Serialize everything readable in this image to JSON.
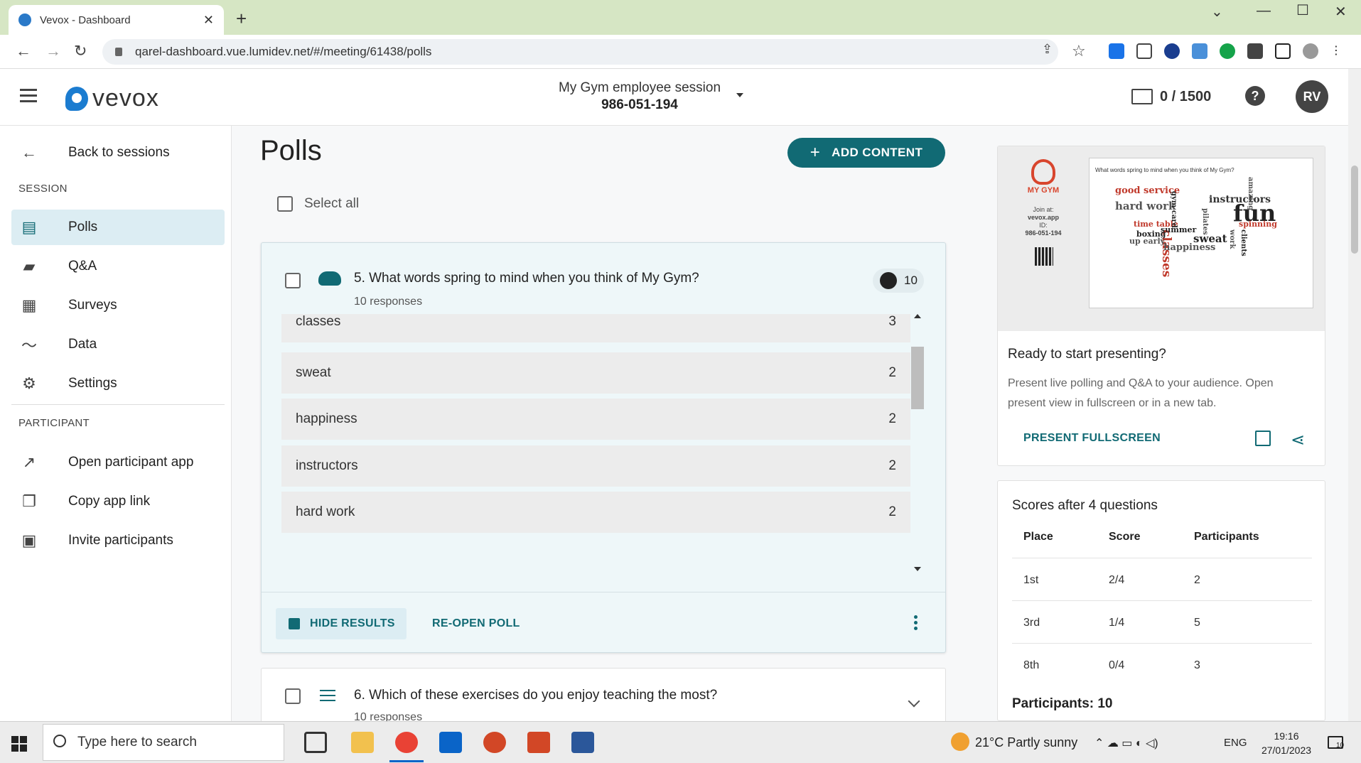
{
  "browser": {
    "tab_title": "Vevox - Dashboard",
    "new_tab_symbol": "+",
    "url": "qarel-dashboard.vue.lumidev.net/#/meeting/61438/polls"
  },
  "header": {
    "logo_text": "vevox",
    "session_name": "My Gym employee session",
    "session_id": "986-051-194",
    "capacity": "0 / 1500",
    "help_symbol": "?",
    "avatar_initials": "RV"
  },
  "sidebar": {
    "back_label": "Back to sessions",
    "session_heading": "SESSION",
    "session_items": [
      {
        "label": "Polls",
        "icon": "polls-icon",
        "active": true
      },
      {
        "label": "Q&A",
        "icon": "qa-icon"
      },
      {
        "label": "Surveys",
        "icon": "surveys-icon"
      },
      {
        "label": "Data",
        "icon": "data-icon"
      },
      {
        "label": "Settings",
        "icon": "gear-icon"
      }
    ],
    "participant_heading": "PARTICIPANT",
    "participant_items": [
      {
        "label": "Open participant app",
        "icon": "external-link-icon"
      },
      {
        "label": "Copy app link",
        "icon": "copy-icon"
      },
      {
        "label": "Invite participants",
        "icon": "calendar-icon"
      }
    ]
  },
  "main": {
    "title": "Polls",
    "add_content_label": "ADD CONTENT",
    "select_all_label": "Select all",
    "poll5": {
      "title": "5. What words spring to mind when you think of My Gym?",
      "responses": "10 responses",
      "participant_count": "10",
      "results": [
        {
          "label": "classes",
          "value": "3"
        },
        {
          "label": "sweat",
          "value": "2"
        },
        {
          "label": "happiness",
          "value": "2"
        },
        {
          "label": "instructors",
          "value": "2"
        },
        {
          "label": "hard work",
          "value": "2"
        }
      ],
      "hide_results_label": "HIDE RESULTS",
      "reopen_label": "RE-OPEN POLL"
    },
    "poll6": {
      "title": "6. Which of these exercises do you enjoy teaching the most?",
      "responses": "10 responses"
    }
  },
  "present": {
    "preview": {
      "brand": "MY GYM",
      "join_line1": "Join at:",
      "join_line2": "vevox.app",
      "join_line3": "ID:",
      "join_line4": "986-051-194",
      "slide_question": "What words spring to mind when you think of My Gym?",
      "words": [
        "good service",
        "hard work",
        "instructors",
        "fun",
        "classes",
        "time table",
        "boxing",
        "summer",
        "up early",
        "sweat",
        "happiness",
        "spinning",
        "amazing",
        "pilates",
        "gym card",
        "clients",
        "work"
      ]
    },
    "question": "Ready to start presenting?",
    "description": "Present live polling and Q&A to your audience. Open present view in fullscreen or in a new tab.",
    "fullscreen_label": "PRESENT FULLSCREEN"
  },
  "scores": {
    "title": "Scores after 4 questions",
    "headers": [
      "Place",
      "Score",
      "Participants"
    ],
    "rows": [
      {
        "place": "1st",
        "score": "2/4",
        "participants": "2"
      },
      {
        "place": "3rd",
        "score": "1/4",
        "participants": "5"
      },
      {
        "place": "8th",
        "score": "0/4",
        "participants": "3"
      }
    ],
    "participants_total": "Participants: 10"
  },
  "taskbar": {
    "search_placeholder": "Type here to search",
    "weather": "21°C  Partly sunny",
    "language": "ENG",
    "time": "19:16",
    "date": "27/01/2023",
    "notifications": "10"
  },
  "colors": {
    "accent": "#116a74",
    "active_bg": "#dcedf3",
    "card_bg": "#eef7f9",
    "brand_blue": "#1b7cd0",
    "gym_red": "#d8452d"
  }
}
